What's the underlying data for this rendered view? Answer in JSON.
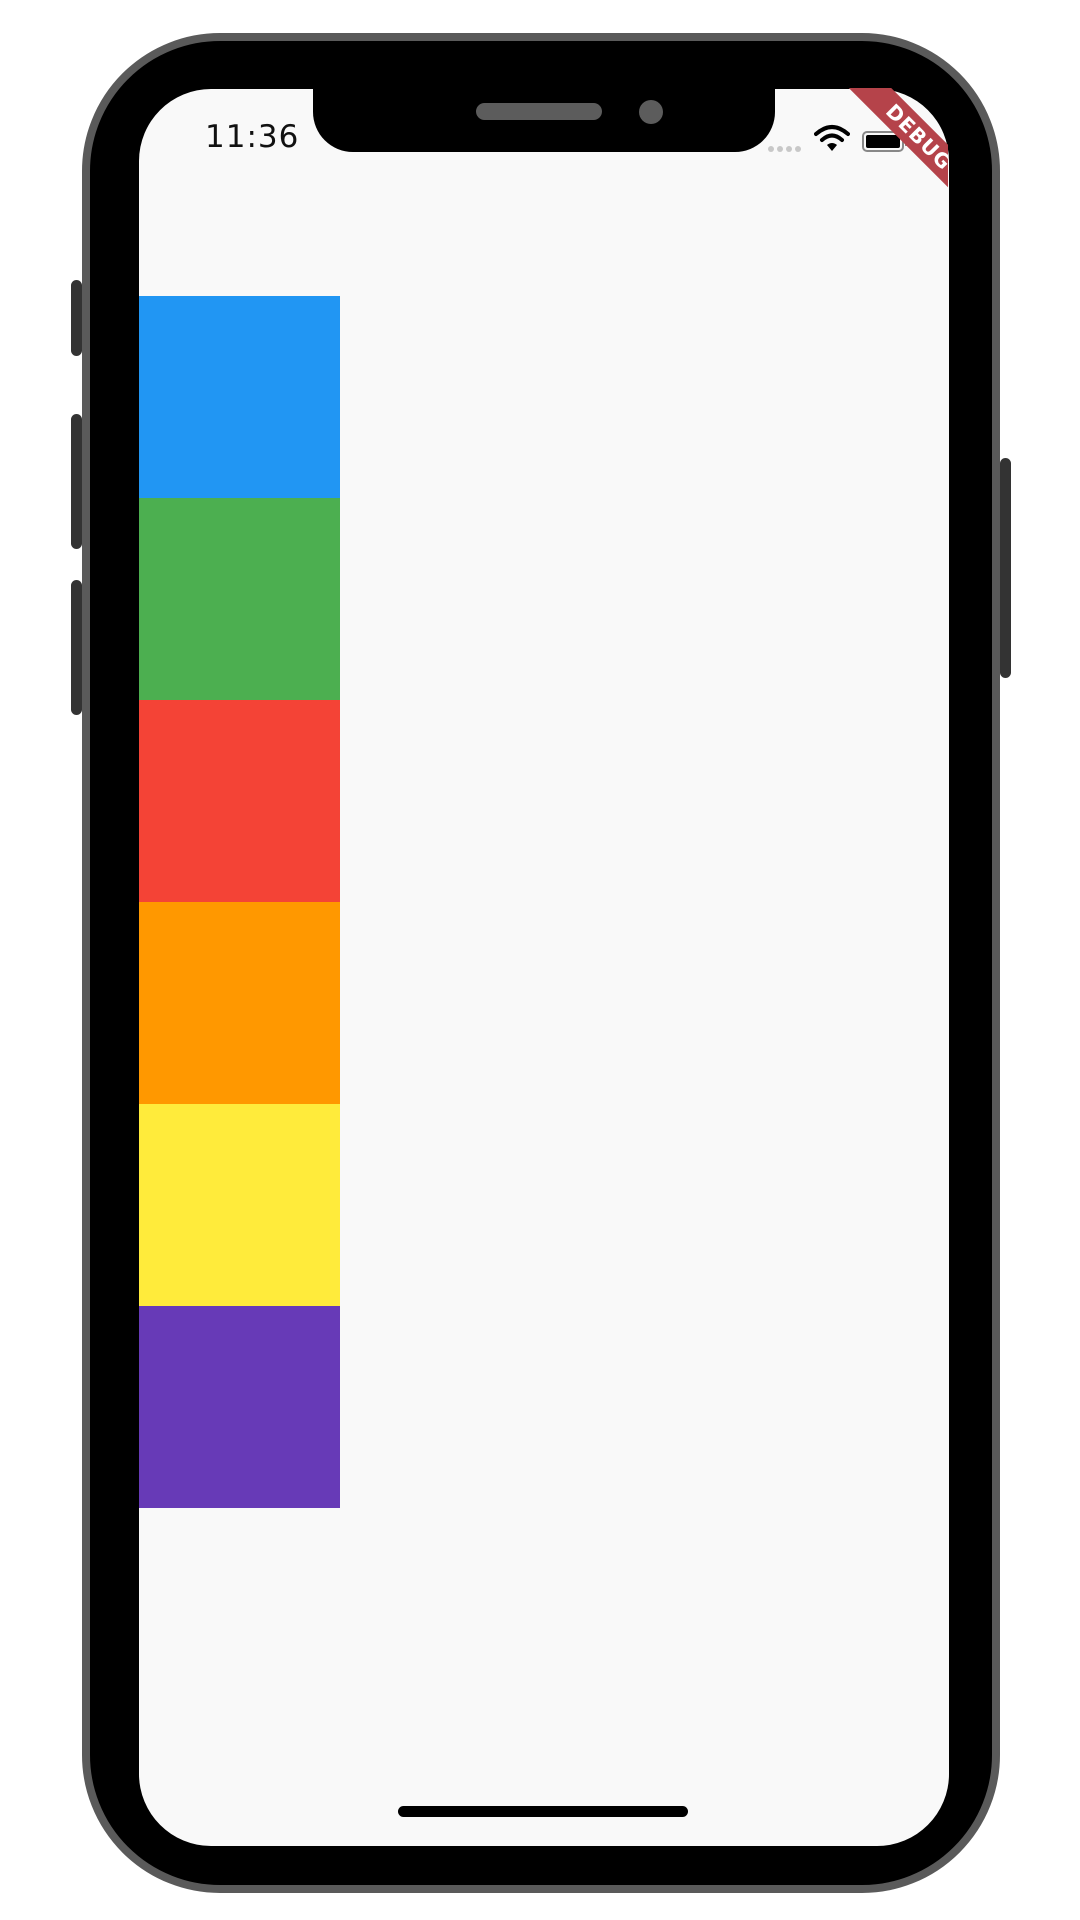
{
  "status_bar": {
    "time": "11:36",
    "signal_icon": "cellular-signal-icon",
    "wifi_icon": "wifi-icon",
    "battery_icon": "battery-icon"
  },
  "debug_banner": {
    "label": "DEBUG",
    "color": "#b5434a"
  },
  "color_boxes": [
    {
      "name": "blue",
      "color": "#2196f3"
    },
    {
      "name": "green",
      "color": "#4caf50"
    },
    {
      "name": "red",
      "color": "#f44336"
    },
    {
      "name": "orange",
      "color": "#ff9800"
    },
    {
      "name": "yellow",
      "color": "#ffeb3b"
    },
    {
      "name": "purple",
      "color": "#673ab7"
    }
  ],
  "theme": {
    "screen_background": "#f9f9f9",
    "bezel": "#000000",
    "frame": "#5a5a5a"
  }
}
